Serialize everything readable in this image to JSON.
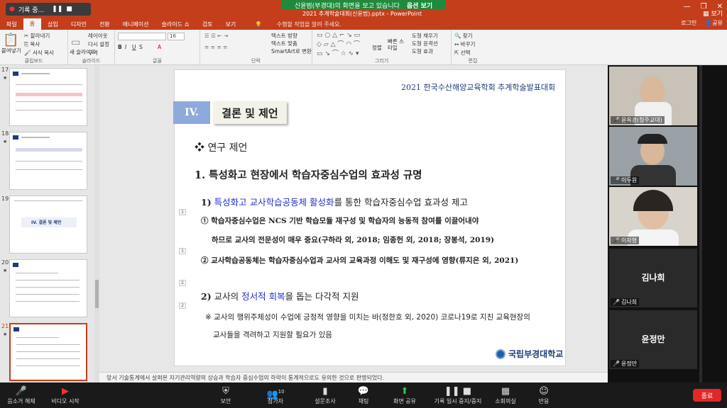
{
  "titlebar": {
    "rec_label": "기록 중...",
    "share_banner": "신윤범(부경대)의 화면을 보고 있습니다",
    "share_options": "옵션 보기",
    "doc_title": "2021 추계학술대회(신윤범).pptx - PowerPoint",
    "view_label": "보기"
  },
  "tabs": [
    "파일",
    "홈",
    "삽입",
    "디자인",
    "전환",
    "애니메이션",
    "슬라이드 쇼",
    "검토",
    "보기"
  ],
  "tab_search": "수행할 작업을 알려 주세요.",
  "tabs_right": {
    "login": "로그인",
    "share": "공유"
  },
  "ribbon": {
    "clipboard": {
      "paste": "붙여넣기",
      "cut": "잘라내기",
      "copy": "복사",
      "format_painter": "서식 복사",
      "label": "클립보드"
    },
    "slides": {
      "new_slide": "새 슬라이드",
      "layout": "레이아웃",
      "reset": "다시 설정",
      "section": "구역",
      "label": "슬라이드"
    },
    "font": {
      "size": "16",
      "label": "글꼴"
    },
    "paragraph": {
      "text_direction": "텍스트 방향",
      "align_text": "텍스트 맞춤",
      "smartart": "SmartArt로 변환",
      "label": "단락"
    },
    "drawing": {
      "arrange": "정렬",
      "quick_styles": "빠른 스타일",
      "fill": "도형 채우기",
      "outline": "도형 윤곽선",
      "effects": "도형 효과",
      "label": "그리기"
    },
    "editing": {
      "find": "찾기",
      "replace": "바꾸기",
      "select": "선택",
      "label": "편집"
    }
  },
  "thumbnails": [
    {
      "num": "17",
      "star": "★"
    },
    {
      "num": "18",
      "star": "★"
    },
    {
      "num": "19",
      "star": "",
      "title": "IV. 결론 및 제언"
    },
    {
      "num": "20",
      "star": "★"
    },
    {
      "num": "21",
      "star": "★"
    }
  ],
  "slide": {
    "header": "2021 한국수산해양교육학회 추계학술발표대회",
    "section_num": "IV.",
    "section_title": "결론 및 제언",
    "subhead": "❖ 연구 제언",
    "h1": "1. 특성화고 현장에서 학습자중심수업의 효과성 규명",
    "s1_num": "1)",
    "s1_blue": "특성화고 교사학습공동체 활성화",
    "s1_rest": "를 통한 학습자중심수업 효과성 제고",
    "i1_line1": "① 학습자중심수업은 NCS 기반 학습모듈 재구성 및 학습자의 능동적 참여를 이끌어내야",
    "i1_line2": "하므로 교사의 전문성이 매우 중요(구하라 외, 2018; 임종헌 외, 2018; 장봉석, 2019)",
    "i2": "② 교사학습공동체는 학습자중심수업과 교사의 교육과정 이해도 및 재구성에 영향(류지은 외, 2021)",
    "s2_num": "2)",
    "s2_pre": "교사의",
    "s2_blue": "정서적 회복",
    "s2_rest": "을 돕는 다각적 지원",
    "note_line1": "※ 교사의 행위주체성이 수업에 긍정적 영향을 미치는 바(정한호 외, 2020) 코로나19로 지친 교육현장의",
    "note_line2": "교사들을 격려하고 지원할 필요가 있음",
    "markers": [
      "1",
      "1",
      "2",
      "2"
    ],
    "logo_text": "국립부경대학교"
  },
  "notes_text": "앞서 기술통계에서 살펴본 자기관리역량의 상승과 학습자 중심수업의 하락이 통계적으로도 유의한 것으로 판명되었다.",
  "participants": [
    {
      "name": "윤옥경(청주교대)",
      "muted": true,
      "video": true
    },
    {
      "name": "이두원",
      "muted": true,
      "video": true
    },
    {
      "name": "이자형",
      "muted": true,
      "video": true
    },
    {
      "name": "김나희",
      "muted": true,
      "video": false
    },
    {
      "name": "윤정만",
      "muted": true,
      "video": false
    }
  ],
  "zoombar": {
    "unmute": "음소거 해제",
    "start_video": "비디오 시작",
    "security": "보안",
    "participants": "참가자",
    "participants_count": "10",
    "polls": "설문조사",
    "chat": "채팅",
    "share_screen": "화면 공유",
    "pause_recording": "기록 일시 중지/중지",
    "breakout": "소회의실",
    "reactions": "반응",
    "end": "종료"
  }
}
